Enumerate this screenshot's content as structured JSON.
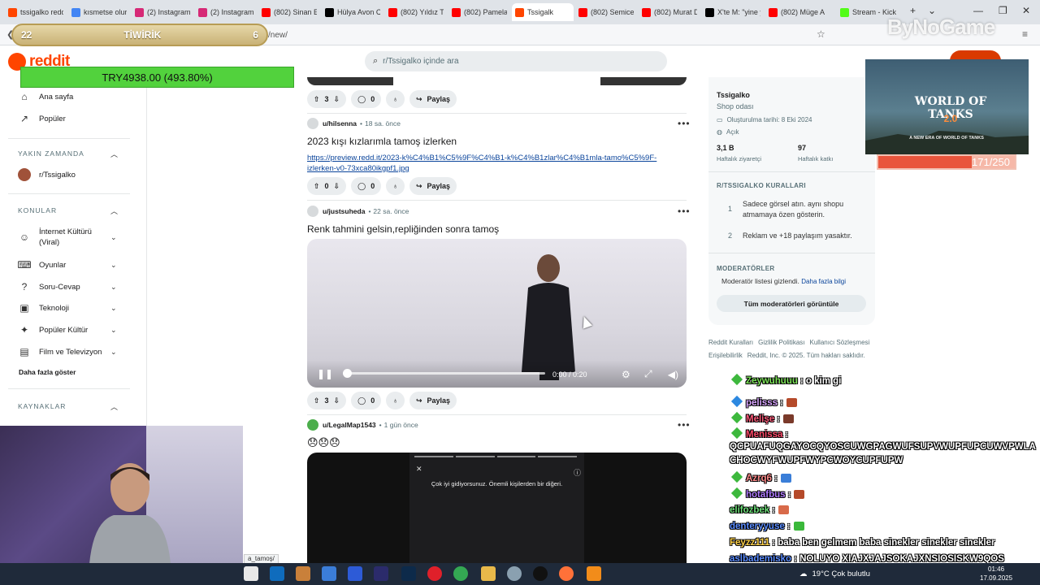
{
  "browser": {
    "tabs": [
      {
        "label": "tssigalko redd",
        "color": "#ff4500"
      },
      {
        "label": "kısmetse olur",
        "color": "#4285f4"
      },
      {
        "label": "(2) Instagram",
        "color": "#d62976"
      },
      {
        "label": "(2) Instagram",
        "color": "#d62976"
      },
      {
        "label": "(802) Sinan En",
        "color": "#ff0000"
      },
      {
        "label": "Hülya Avon Cı",
        "color": "#000000"
      },
      {
        "label": "(802) Yıldız Tilt",
        "color": "#ff0000"
      },
      {
        "label": "(802) Pamela",
        "color": "#ff0000"
      },
      {
        "label": "Tssigalk",
        "color": "#ff4500"
      },
      {
        "label": "(802) Semicen",
        "color": "#ff0000"
      },
      {
        "label": "(802) Murat D",
        "color": "#ff0000"
      },
      {
        "label": "X'te M: \"yine y",
        "color": "#000000"
      },
      {
        "label": "(802) Müge A",
        "color": "#ff0000"
      },
      {
        "label": "Stream - Kick",
        "color": "#53fc18"
      }
    ],
    "url": "/new/"
  },
  "reddit": {
    "logo": "reddit",
    "search_placeholder": "r/Tssigalko içinde ara",
    "brand_color": "#ff4500"
  },
  "nav": {
    "home": "Ana sayfa",
    "popular": "Popüler",
    "recent_header": "YAKIN ZAMANDA",
    "recent_sub": "r/Tssigalko",
    "topics_header": "KONULAR",
    "topics": [
      "İnternet Kültürü (Viral)",
      "Oyunlar",
      "Soru-Cevap",
      "Teknoloji",
      "Popüler Kültür",
      "Film ve Televizyon"
    ],
    "show_more": "Daha fazla göster",
    "resources_header": "KAYNAKLAR"
  },
  "posts": [
    {
      "upvotes": "3",
      "comments": "0",
      "share": "Paylaş"
    },
    {
      "user": "u/hilsenna",
      "time": "18 sa. önce",
      "title": "2023 kışı kızlarımla tamoş izlerken",
      "link": "https://preview.redd.it/2023-k%C4%B1%C5%9F%C4%B1-k%C4%B1zlar%C4%B1mla-tamo%C5%9F-izlerken-v0-73xca80ikgpf1.jpg",
      "upvotes": "0",
      "comments": "0",
      "share": "Paylaş"
    },
    {
      "user": "u/justsuheda",
      "time": "22 sa. önce",
      "title": "Renk tahmini gelsin,repliğinden sonra tamoş",
      "video_time": "0:00 / 0:20",
      "upvotes": "3",
      "comments": "0",
      "share": "Paylaş"
    },
    {
      "user": "u/LegalMap1543",
      "time": "1 gün önce",
      "title": "😞😞😞",
      "story_caption": "Çok iyi gidiyorsunuz. Önemli kişilerden bir diğeri."
    }
  ],
  "sidebar": {
    "name": "Tssigalko",
    "subtitle": "Shop odası",
    "created": "Oluşturulma tarihi: 8 Eki 2024",
    "status": "Açık",
    "visitors_value": "3,1 B",
    "visitors_label": "Haftalık ziyaretçi",
    "contrib_value": "97",
    "contrib_label": "Haftalık katkı",
    "rules_header": "R/TSSIGALKO KURALLARI",
    "rules": [
      {
        "num": "1",
        "text": "Sadece görsel atın. aynı shopu atmamaya özen gösterin."
      },
      {
        "num": "2",
        "text": "Reklam ve +18 paylaşım yasaktır."
      }
    ],
    "mods_header": "MODERATÖRLER",
    "mods_text": "Moderatör listesi gizlendi.",
    "mods_link": "Daha fazla bilgi",
    "mods_button": "Tüm moderatörleri görüntüle",
    "footer1": [
      "Reddit Kuralları",
      "Gizlilik Politikası",
      "Kullanıcı Sözleşmesi"
    ],
    "footer2": [
      "Erişilebilirlik",
      "Reddit, Inc. © 2025. Tüm hakları saklıdır."
    ]
  },
  "overlay": {
    "tiwirik_left": "22",
    "tiwirik_title": "TİWİRİK",
    "tiwirik_right": "6",
    "try_value": "TRY4938.00 (493.80%)",
    "wot_logo": "WORLD OF TANKS",
    "wot_version": "2.0",
    "wot_tag": "A NEW ERA OF WORLD OF TANKS",
    "hp_text": "171/250",
    "hp_fraction": 0.684,
    "watermark": "ByNoGame"
  },
  "chat": [
    {
      "user": "Zeywuhuuu",
      "msg": ": o kim gi",
      "color": "#7ee65a",
      "badge": "green"
    },
    {
      "user": "pelisss",
      "msg": ":",
      "color": "#d9a6ff",
      "badge": "blue",
      "emote": "#b54a2a"
    },
    {
      "user": "Melişe",
      "msg": ":",
      "color": "#ff5a7a",
      "badge": "green",
      "emote": "#7a3a2a"
    },
    {
      "user": "Menissa",
      "msg": ":",
      "color": "#ff4a6a",
      "badge": "green"
    },
    {
      "user": "",
      "msg": "QCPUAFUQGAYOCQYOSCUWGPAGWUFSUPVWUPFUPCUWVPWLA",
      "color": "#ffffff"
    },
    {
      "user": "",
      "msg": "CHOCWYFWUPFWYPCWOYCUPFUPW",
      "color": "#ffffff"
    },
    {
      "user": "Azrq6",
      "msg": ":",
      "color": "#ff8c8c",
      "badge": "green",
      "emote": "#3a7ed8"
    },
    {
      "user": "hotafbus",
      "msg": ":",
      "color": "#b07cff",
      "badge": "green",
      "emote": "#b54a2a"
    },
    {
      "user": "elifozbek",
      "msg": ":",
      "color": "#6ee07a",
      "emote": "#d86a4a"
    },
    {
      "user": "denteryyuse",
      "msg": ":",
      "color": "#5a8cff",
      "emote": "#3ab83a"
    },
    {
      "user": "Feyzz111",
      "msg": ": baba ben gelmem baba sinekler sinekler sinekler",
      "color": "#ffd24a"
    },
    {
      "user": "aslbademisko",
      "msg": ": NOLUYO XIAJXJAJSOKAJXNSIOSISKW9QOS",
      "color": "#5a8cff"
    }
  ],
  "taskbar": {
    "weather": "19°C  Çok bulutlu",
    "time": "01:46",
    "date": "17.09.2025"
  },
  "statuslink": "a_tamoş/"
}
